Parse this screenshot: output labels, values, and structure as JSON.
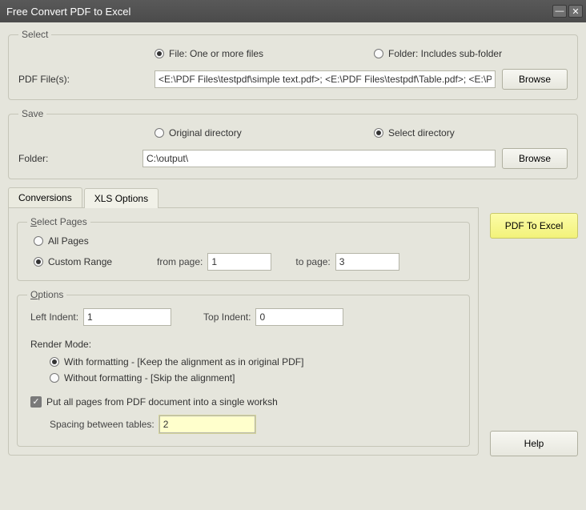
{
  "title": "Free Convert PDF to Excel",
  "select": {
    "legend": "Select",
    "file_radio": "File:  One or more files",
    "folder_radio": "Folder: Includes sub-folder",
    "file_selected": true,
    "pdf_files_label": "PDF File(s):",
    "pdf_files_value": "<E:\\PDF Files\\testpdf\\simple text.pdf>; <E:\\PDF Files\\testpdf\\Table.pdf>; <E:\\PDF",
    "browse": "Browse"
  },
  "save": {
    "legend": "Save",
    "original_radio": "Original directory",
    "select_radio": "Select directory",
    "select_selected": true,
    "folder_label": "Folder:",
    "folder_value": "C:\\output\\",
    "browse": "Browse"
  },
  "tabs": {
    "conversions": "Conversions",
    "xls_options": "XLS Options"
  },
  "select_pages": {
    "legend_letter": "S",
    "legend_rest": "elect Pages",
    "all_pages": "All Pages",
    "custom_range": "Custom Range",
    "custom_selected": true,
    "from_label": "from page:",
    "from_value": "1",
    "to_label": "to page:",
    "to_value": "3"
  },
  "options": {
    "legend_letter": "O",
    "legend_rest": "ptions",
    "left_indent_label": "Left Indent:",
    "left_indent_value": "1",
    "top_indent_label": "Top Indent:",
    "top_indent_value": "0",
    "render_mode_label": "Render Mode:",
    "with_formatting": "With formatting - [Keep the alignment as in original PDF]",
    "without_formatting": "Without formatting - [Skip the alignment]",
    "with_selected": true,
    "single_worksheet": "Put all pages from PDF document into a single worksh",
    "single_checked": true,
    "spacing_label": "Spacing between tables:",
    "spacing_value": "2"
  },
  "actions": {
    "convert": "PDF To Excel",
    "help": "Help"
  }
}
